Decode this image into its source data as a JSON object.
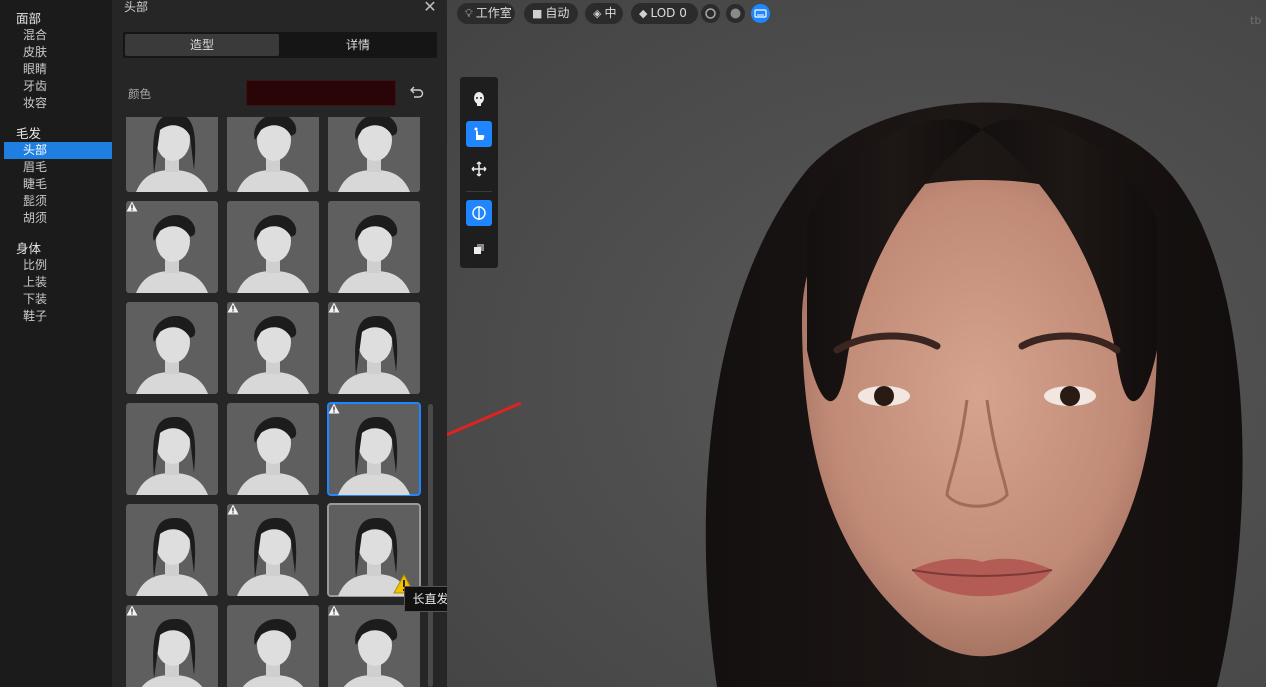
{
  "nav": {
    "groups": [
      {
        "title": "面部",
        "items": [
          "混合",
          "皮肤",
          "眼睛",
          "牙齿",
          "妆容"
        ]
      },
      {
        "title": "毛发",
        "items": [
          "头部",
          "眉毛",
          "睫毛",
          "髭须",
          "胡须"
        ]
      },
      {
        "title": "身体",
        "items": [
          "比例",
          "上装",
          "下装",
          "鞋子"
        ]
      }
    ],
    "active_item": "头部"
  },
  "panel": {
    "title": "头部",
    "close_icon": "close-icon",
    "tabs": [
      "造型",
      "详情"
    ],
    "active_tab": "造型",
    "color_label": "颜色",
    "color_value": "#2a0508",
    "reset_icon": "undo-icon",
    "tooltip": "长直发",
    "hair_presets": [
      {
        "row": 0,
        "col": 0,
        "style": "short-swept",
        "warning": true
      },
      {
        "row": 0,
        "col": 1,
        "style": "short-crop",
        "warning": false
      },
      {
        "row": 0,
        "col": 2,
        "style": "short-fringe",
        "warning": true
      },
      {
        "row": 1,
        "col": 0,
        "style": "short-spiky",
        "warning": true
      },
      {
        "row": 1,
        "col": 1,
        "style": "short-side",
        "warning": false
      },
      {
        "row": 1,
        "col": 2,
        "style": "short-messy",
        "warning": false
      },
      {
        "row": 2,
        "col": 0,
        "style": "bun-low",
        "warning": false
      },
      {
        "row": 2,
        "col": 1,
        "style": "side-part-medium",
        "warning": true
      },
      {
        "row": 2,
        "col": 2,
        "style": "bob-curl",
        "warning": true
      },
      {
        "row": 3,
        "col": 0,
        "style": "swept-long",
        "warning": false
      },
      {
        "row": 3,
        "col": 1,
        "style": "tied-back",
        "warning": false
      },
      {
        "row": 3,
        "col": 2,
        "style": "straight-bob",
        "warning": true,
        "selected": true
      },
      {
        "row": 4,
        "col": 0,
        "style": "wavy-medium",
        "warning": false
      },
      {
        "row": 4,
        "col": 1,
        "style": "long-wavy",
        "warning": true
      },
      {
        "row": 4,
        "col": 2,
        "style": "long-straight",
        "warning": true,
        "hovered": true
      },
      {
        "row": 5,
        "col": 0,
        "style": "bangs-long",
        "warning": true
      },
      {
        "row": 5,
        "col": 1,
        "style": "short-neat",
        "warning": false
      },
      {
        "row": 5,
        "col": 2,
        "style": "top-bun",
        "warning": true
      }
    ]
  },
  "viewport": {
    "toolbar": [
      {
        "icon": "lightbulb-icon",
        "label": "工作室"
      },
      {
        "icon": "camera-icon",
        "label": "自动"
      },
      {
        "icon": "diamond-icon",
        "label": "中"
      },
      {
        "icon": "cube-icon",
        "label": "LOD 0"
      }
    ],
    "toggles": [
      "material-icon",
      "sphere-icon",
      "keyboard-icon"
    ],
    "active_toggle": "keyboard-icon",
    "corner_text": "tb",
    "tools": [
      "head-icon",
      "hand-pointer-icon",
      "move-icon",
      "symmetry-icon",
      "layers-icon"
    ],
    "active_tools": [
      "hand-pointer-icon",
      "symmetry-icon"
    ],
    "accent": "#1f86ff"
  }
}
